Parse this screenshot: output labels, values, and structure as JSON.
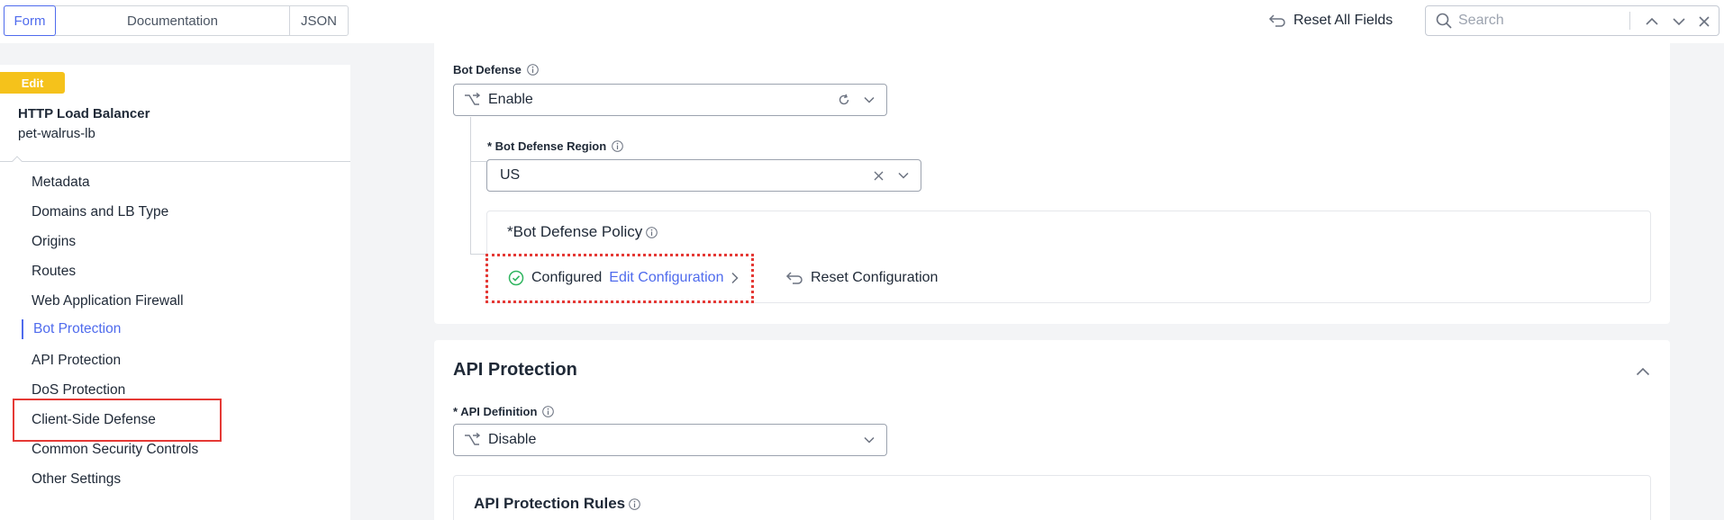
{
  "top_tabs": [
    {
      "label": "Form",
      "active": true
    },
    {
      "label": "Documentation",
      "active": false
    },
    {
      "label": "JSON",
      "active": false
    }
  ],
  "toolbar": {
    "reset_all_label": "Reset All Fields"
  },
  "search": {
    "placeholder": "Search",
    "value": ""
  },
  "sidebar": {
    "badge": "Edit",
    "object_type": "HTTP Load Balancer",
    "object_name": "pet-walrus-lb",
    "items": [
      {
        "label": "Metadata"
      },
      {
        "label": "Domains and LB Type"
      },
      {
        "label": "Origins"
      },
      {
        "label": "Routes"
      },
      {
        "label": "Web Application Firewall"
      },
      {
        "label": "Bot Protection",
        "active": true
      },
      {
        "label": "API Protection"
      },
      {
        "label": "DoS Protection"
      },
      {
        "label": "Client-Side Defense"
      },
      {
        "label": "Common Security Controls"
      },
      {
        "label": "Other Settings"
      }
    ]
  },
  "bot_defense": {
    "label": "Bot Defense",
    "value": "Enable",
    "region_label": "* Bot Defense Region",
    "region_value": "US",
    "policy_title": "*Bot Defense Policy",
    "status": "Configured",
    "edit_link": "Edit Configuration",
    "reset_label": "Reset Configuration"
  },
  "api_protection": {
    "title": "API Protection",
    "definition_label": "* API Definition",
    "definition_value": "Disable",
    "rules_title": "API Protection Rules"
  },
  "colors": {
    "accent": "#4f6bed",
    "badge": "#f5c21b",
    "highlight": "#e53935",
    "success": "#2fb55f"
  }
}
